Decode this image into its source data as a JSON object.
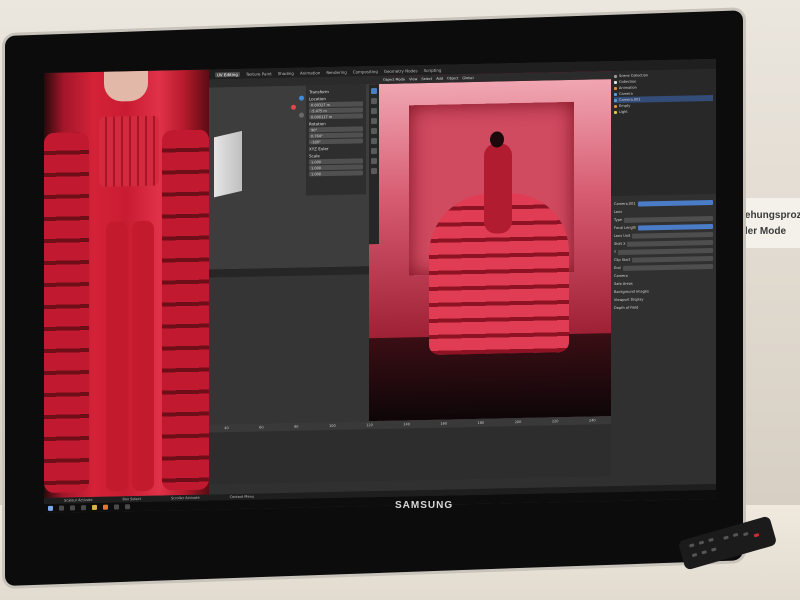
{
  "wall_sign": {
    "line1": "stehungsproz",
    "line2": "taler Mode"
  },
  "tv": {
    "brand": "SAMSUNG"
  },
  "blender": {
    "workspace_tabs": [
      "UV Editing",
      "Texture Paint",
      "Shading",
      "Animation",
      "Rendering",
      "Compositing",
      "Geometry Nodes",
      "Scripting"
    ],
    "viewport_header": [
      "Object Mode",
      "View",
      "Select",
      "Add",
      "Object",
      "Global"
    ],
    "npanel": {
      "sections": [
        "Transform",
        "Location",
        "Rotation",
        "XYZ Euler",
        "Scale"
      ],
      "location": [
        "0.00327 m",
        "-5.475 m",
        "0.000117 m"
      ],
      "rotation": [
        "90°",
        "0.764°",
        "-180°"
      ],
      "scale": [
        "1.000",
        "1.000",
        "1.000"
      ]
    },
    "outliner": [
      "Scene Collection",
      "Collection",
      "Animation",
      "Camera",
      "Camera.001",
      "Empty",
      "Light"
    ],
    "properties": [
      "Camera.001",
      "Lens",
      "Type",
      "Focal Length",
      "Lens Unit",
      "Shift X",
      "Y",
      "Clip Start",
      "End",
      "Camera",
      "Safe Areas",
      "Background Images",
      "Viewport Display",
      "Depth of Field"
    ],
    "timeline_ticks": [
      "40",
      "60",
      "80",
      "100",
      "120",
      "140",
      "160",
      "180",
      "200",
      "220",
      "240"
    ],
    "status": [
      "Scaleur Activate",
      "Box Select",
      "Scroller Activate",
      "Context Menu"
    ]
  }
}
